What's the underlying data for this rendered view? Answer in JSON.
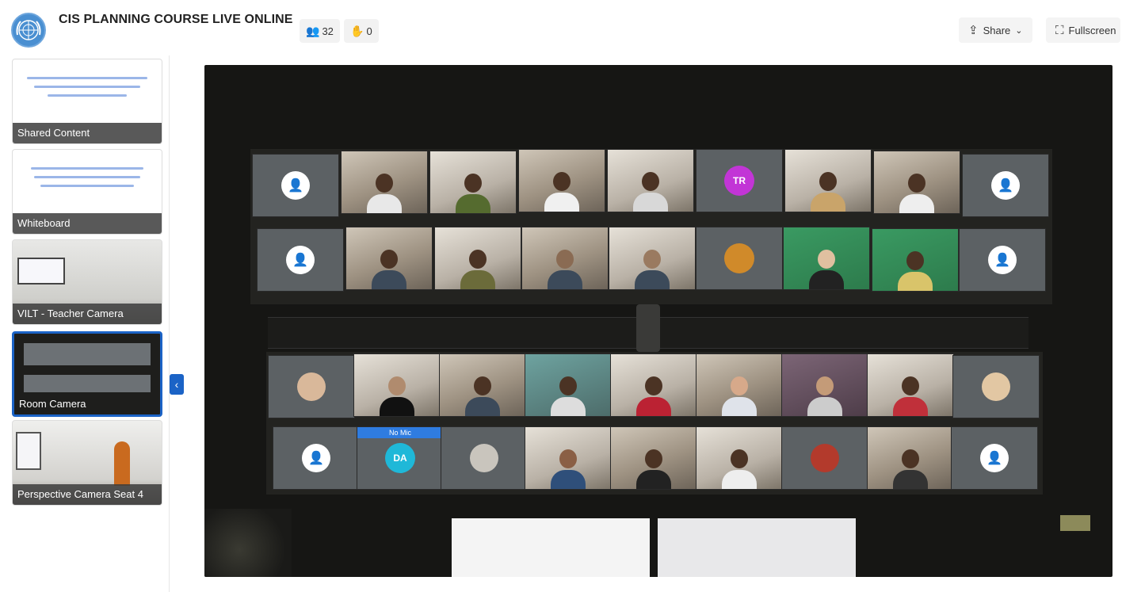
{
  "header": {
    "title": "CIS PLANNING COURSE LIVE ONLINE",
    "participants_count": "32",
    "raised_hands_count": "0",
    "share_label": "Share",
    "fullscreen_label": "Fullscreen"
  },
  "sidebar": {
    "items": [
      {
        "label": "Shared Content",
        "selected": false
      },
      {
        "label": "Whiteboard",
        "selected": false
      },
      {
        "label": "VILT - Teacher Camera",
        "selected": false
      },
      {
        "label": "Room Camera",
        "selected": true
      },
      {
        "label": "Perspective Camera Seat 4",
        "selected": false
      }
    ]
  },
  "stage": {
    "tile_badges": {
      "tr_initials": "TR",
      "da_initials": "DA",
      "no_mic": "No Mic"
    }
  },
  "colors": {
    "accent": "#1b63c6",
    "tr_avatar": "#c235d6",
    "da_avatar": "#1fb8d8"
  },
  "icons": [
    "un-logo-icon",
    "participants-icon",
    "raised-hand-icon",
    "share-icon",
    "chevron-down-icon",
    "fullscreen-icon",
    "chevron-left-icon",
    "user-avatar-icon"
  ]
}
